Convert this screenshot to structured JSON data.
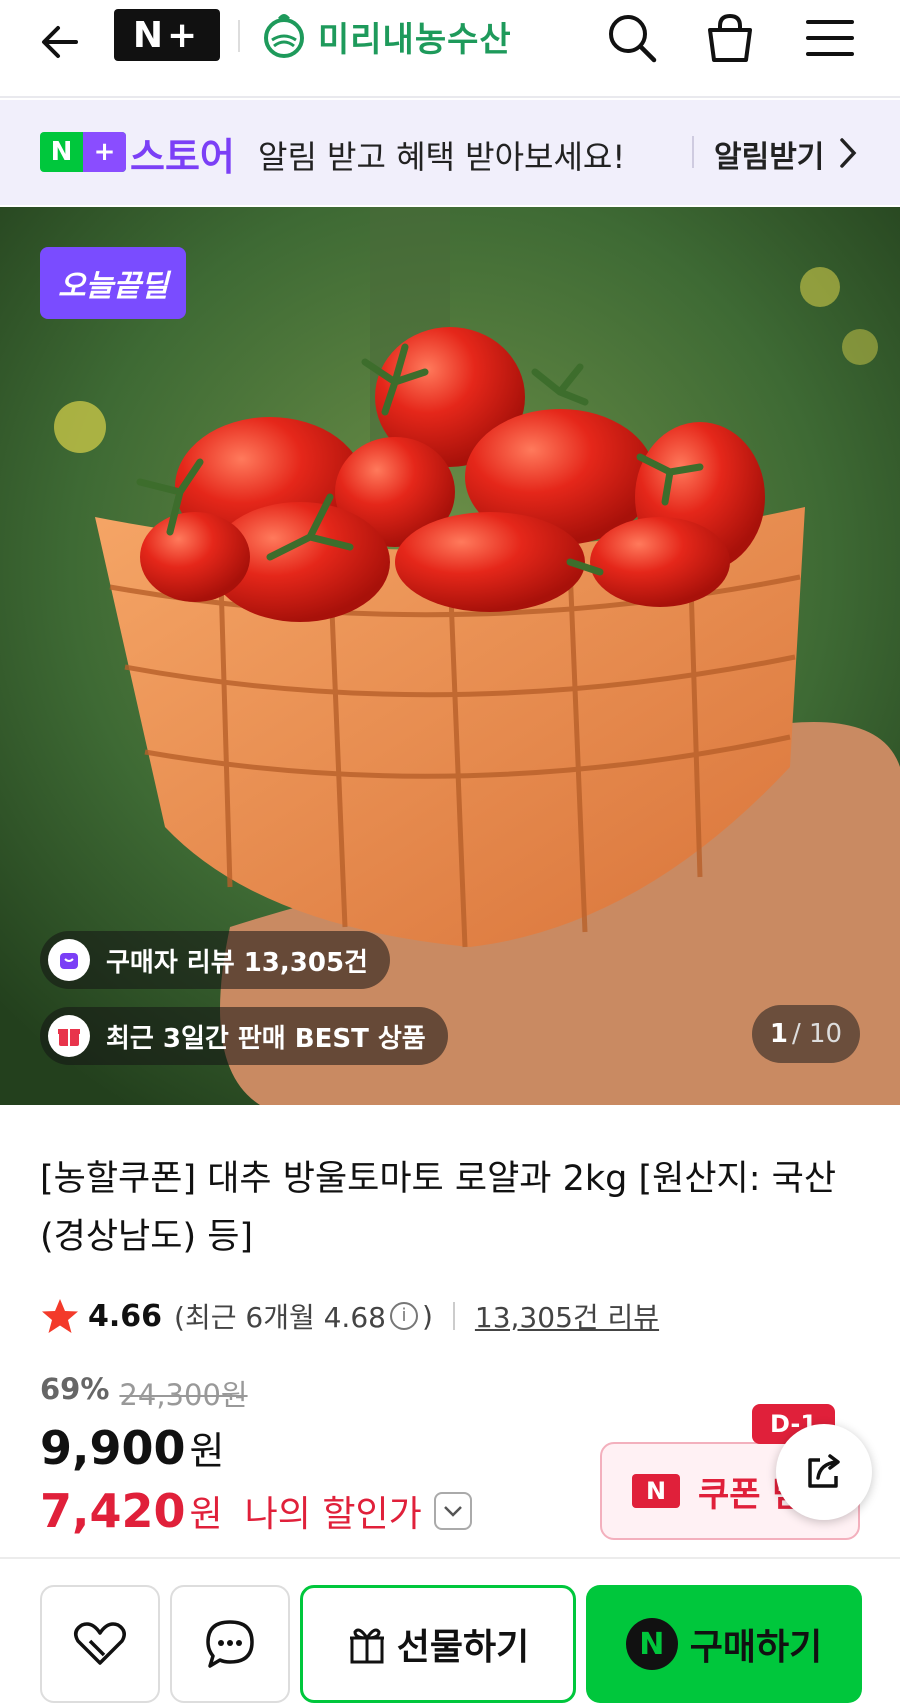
{
  "header": {
    "nplus_logo_text": "N+",
    "store_name": "미리내농수산",
    "icons": [
      "back-arrow-icon",
      "search-icon",
      "cart-icon",
      "menu-icon"
    ]
  },
  "notice": {
    "brand_badge": "N+",
    "brand_store": "스토어",
    "message": "알림 받고 혜택 받아보세요!",
    "action": "알림받기"
  },
  "hero": {
    "deal_badge": "오늘끝딜",
    "review_pill": "구매자 리뷰 13,305건",
    "best_pill": "최근 3일간 판매 BEST 상품",
    "pager_current": "1",
    "pager_total": "/ 10"
  },
  "product": {
    "title": "[농할쿠폰] 대추 방울토마토 로얄과 2kg [원산지: 국산(경상남도) 등]",
    "rating_score": "4.66",
    "rating_recent_open": "(최근 6개월 4.68",
    "rating_recent_close": ")",
    "review_count": "13,305건 리뷰",
    "discount_rate": "69%",
    "original_price": "24,300원",
    "price_value": "9,900",
    "price_unit": "원",
    "my_price_value": "7,420",
    "my_price_unit": "원",
    "my_price_label": "나의 할인가",
    "coupon_logo": "N",
    "coupon_label": "쿠폰 받",
    "dday_badge": "D-1"
  },
  "bottom_bar": {
    "gift_label": "선물하기",
    "buy_logo": "N",
    "buy_label": "구매하기"
  },
  "colors": {
    "naver_green": "#00c73c",
    "nplus_purple": "#7b3ff6",
    "price_red": "#e0203a",
    "store_green": "#1e9a5b"
  }
}
